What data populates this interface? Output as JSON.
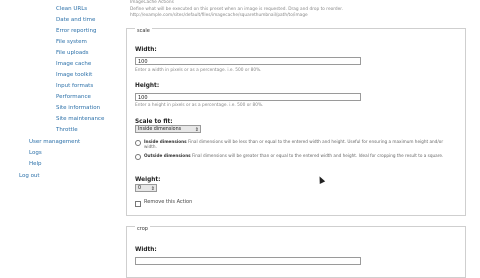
{
  "sidebar": {
    "items": [
      {
        "label": "Clean URLs"
      },
      {
        "label": "Date and time"
      },
      {
        "label": "Error reporting"
      },
      {
        "label": "File system"
      },
      {
        "label": "File uploads"
      },
      {
        "label": "Image cache"
      },
      {
        "label": "Image toolkit"
      },
      {
        "label": "Input formats"
      },
      {
        "label": "Performance"
      },
      {
        "label": "Site information"
      },
      {
        "label": "Site maintenance"
      },
      {
        "label": "Throttle"
      },
      {
        "label": "User management"
      },
      {
        "label": "Logs"
      },
      {
        "label": "Help"
      },
      {
        "label": "Log out"
      }
    ]
  },
  "top": {
    "heading": "ImageCache Actions",
    "hint_line_1": "Define what will be executed on this preset when an image is requested. Drag and drop to reorder.",
    "hint_line_2": "http://example.com/sites/default/files/imagecache/squarethumbnail/path/to/image"
  },
  "scale": {
    "legend": "scale",
    "width_label": "Width:",
    "width_value": "100",
    "width_hint": "Enter a width in pixels or as a percentage. i.e. 500 or 80%.",
    "height_label": "Height:",
    "height_value": "100",
    "height_hint": "Enter a height in pixels or as a percentage. i.e. 500 or 80%.",
    "fit_label": "Scale to fit:",
    "fit_value": "Inside dimensions",
    "fit_option_1_title": "Inside dimensions",
    "fit_option_1_text": "Final dimensions will be less than or equal to the entered width and height. Useful for ensuring a maximum height and/or width.",
    "fit_option_2_title": "Outside dimensions",
    "fit_option_2_text": "Final dimensions will be greater than or equal to the entered width and height. Ideal for cropping the result to a square.",
    "weight_label": "Weight:",
    "weight_value": "0",
    "remove_label": "Remove this Action"
  },
  "crop": {
    "legend": "crop",
    "width_label": "Width:"
  }
}
